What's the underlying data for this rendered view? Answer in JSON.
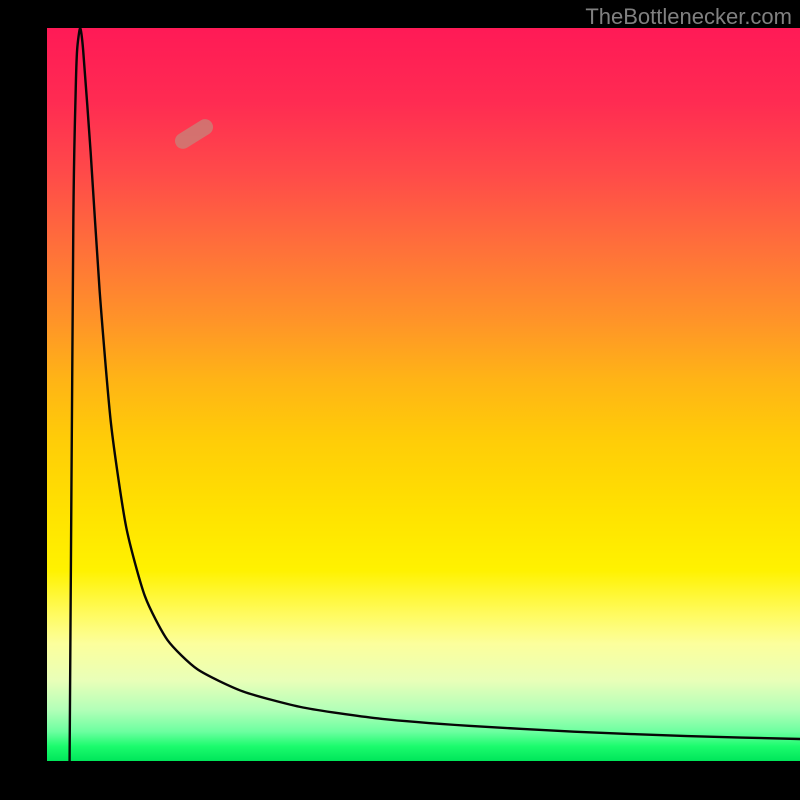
{
  "watermark": "TheBottlenecker.com",
  "chart_data": {
    "type": "line",
    "title": "",
    "xlabel": "",
    "ylabel": "",
    "xlim": [
      0,
      1
    ],
    "ylim": [
      0,
      1
    ],
    "series": [
      {
        "name": "curve",
        "points": [
          [
            0.03,
            0.0
          ],
          [
            0.035,
            0.74
          ],
          [
            0.038,
            0.91
          ],
          [
            0.04,
            0.97
          ],
          [
            0.044,
            1.0
          ],
          [
            0.048,
            0.97
          ],
          [
            0.058,
            0.83
          ],
          [
            0.07,
            0.64
          ],
          [
            0.085,
            0.46
          ],
          [
            0.105,
            0.32
          ],
          [
            0.13,
            0.225
          ],
          [
            0.16,
            0.165
          ],
          [
            0.2,
            0.125
          ],
          [
            0.26,
            0.095
          ],
          [
            0.34,
            0.073
          ],
          [
            0.44,
            0.058
          ],
          [
            0.56,
            0.048
          ],
          [
            0.7,
            0.04
          ],
          [
            0.85,
            0.034
          ],
          [
            1.0,
            0.03
          ]
        ]
      }
    ],
    "marker": {
      "x": 0.195,
      "y": 0.855,
      "note": "highlight segment"
    },
    "background_gradient": [
      "#ff1a56",
      "#ffb416",
      "#ffe200",
      "#1bfb6d",
      "#00e65a"
    ]
  }
}
